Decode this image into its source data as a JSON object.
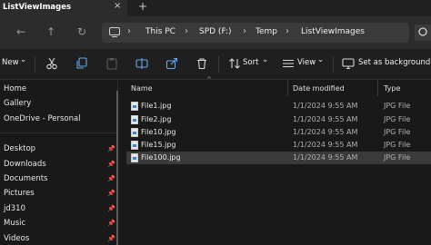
{
  "tab": {
    "title": "ListViewImages",
    "close_glyph": "×",
    "new_glyph": "+"
  },
  "nav": {
    "back_glyph": "←",
    "forward_glyph": "→",
    "up_glyph": "↑",
    "refresh_glyph": "↻"
  },
  "address": {
    "crumbs": [
      "This PC",
      "SPD (F:)",
      "Temp",
      "ListViewImages"
    ],
    "separator": "›"
  },
  "toolbar": {
    "new_label": "New",
    "sort_label": "Sort",
    "view_label": "View",
    "background_label": "Set as background",
    "chevron": "⌄"
  },
  "sidebar": {
    "items": [
      {
        "label": "Home"
      },
      {
        "label": "Gallery"
      },
      {
        "label": "OneDrive - Personal"
      },
      {
        "label": "Desktop"
      },
      {
        "label": "Downloads"
      },
      {
        "label": "Documents"
      },
      {
        "label": "Pictures"
      },
      {
        "label": "jd310"
      },
      {
        "label": "Music"
      },
      {
        "label": "Videos"
      }
    ],
    "pin_glyph": "📌"
  },
  "columns": {
    "name": "Name",
    "date": "Date modified",
    "type": "Type",
    "sort_glyph": "^"
  },
  "files": [
    {
      "name": "File1.jpg",
      "date": "1/1/2024 9:55 AM",
      "type": "JPG File"
    },
    {
      "name": "File2.jpg",
      "date": "1/1/2024 9:55 AM",
      "type": "JPG File"
    },
    {
      "name": "File10.jpg",
      "date": "1/1/2024 9:55 AM",
      "type": "JPG File"
    },
    {
      "name": "File15.jpg",
      "date": "1/1/2024 9:55 AM",
      "type": "JPG File"
    },
    {
      "name": "File100.jpg",
      "date": "1/1/2024 9:55 AM",
      "type": "JPG File"
    }
  ],
  "selected_file": "File100.jpg",
  "colors": {
    "accent": "#3a84d6",
    "selection": "#3a3a3a"
  }
}
